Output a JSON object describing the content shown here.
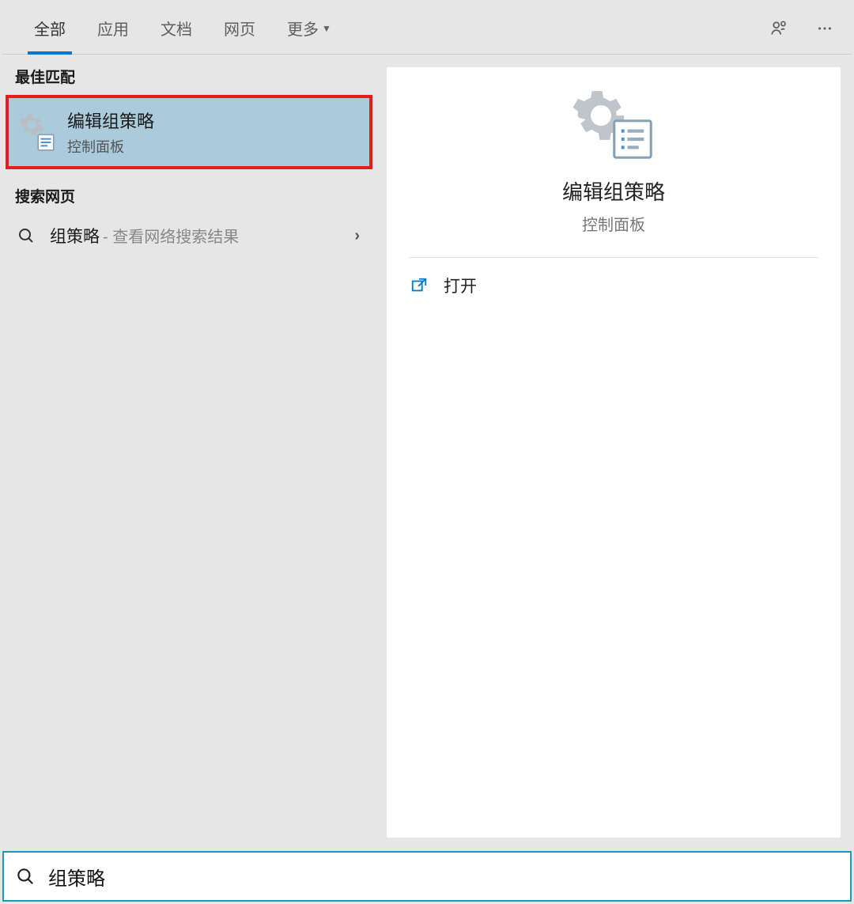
{
  "tabs": {
    "all": "全部",
    "apps": "应用",
    "docs": "文档",
    "web": "网页",
    "more": "更多"
  },
  "left": {
    "best_match_header": "最佳匹配",
    "best_match": {
      "title": "编辑组策略",
      "subtitle": "控制面板"
    },
    "search_web_header": "搜索网页",
    "web_item": {
      "term": "组策略",
      "hint": "- 查看网络搜索结果"
    }
  },
  "detail": {
    "title": "编辑组策略",
    "subtitle": "控制面板",
    "open_label": "打开"
  },
  "search": {
    "value": "组策略"
  }
}
